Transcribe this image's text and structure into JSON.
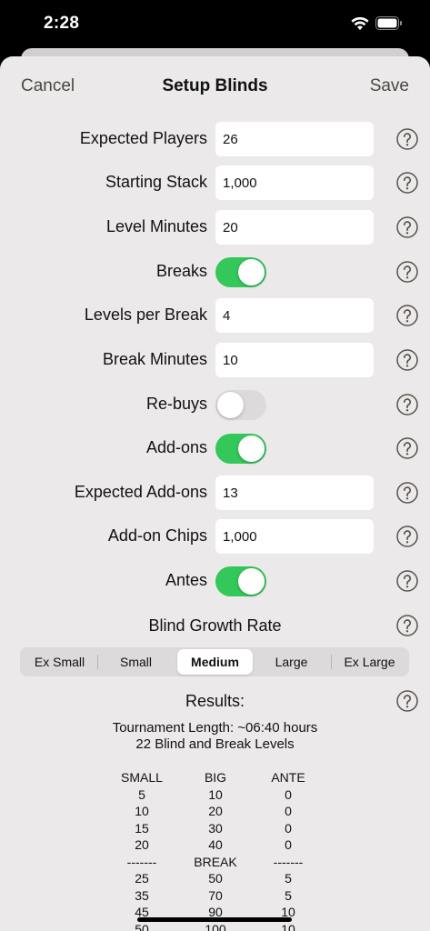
{
  "status": {
    "time": "2:28"
  },
  "nav": {
    "cancel": "Cancel",
    "title": "Setup Blinds",
    "save": "Save"
  },
  "form": {
    "expected_players": {
      "label": "Expected Players",
      "value": "26"
    },
    "starting_stack": {
      "label": "Starting Stack",
      "value": "1,000"
    },
    "level_minutes": {
      "label": "Level Minutes",
      "value": "20"
    },
    "breaks": {
      "label": "Breaks",
      "on": true
    },
    "levels_per_break": {
      "label": "Levels per Break",
      "value": "4"
    },
    "break_minutes": {
      "label": "Break Minutes",
      "value": "10"
    },
    "rebuys": {
      "label": "Re-buys",
      "on": false
    },
    "addons": {
      "label": "Add-ons",
      "on": true
    },
    "expected_addons": {
      "label": "Expected Add-ons",
      "value": "13"
    },
    "addon_chips": {
      "label": "Add-on Chips",
      "value": "1,000"
    },
    "antes": {
      "label": "Antes",
      "on": true
    }
  },
  "growth": {
    "label": "Blind Growth Rate",
    "options": [
      "Ex Small",
      "Small",
      "Medium",
      "Large",
      "Ex Large"
    ],
    "selected": "Medium"
  },
  "results": {
    "title": "Results:",
    "length": "Tournament Length: ~06:40 hours",
    "levels": "22 Blind and Break Levels",
    "columns": {
      "small": [
        "SMALL",
        "5",
        "10",
        "15",
        "20",
        "-------",
        "25",
        "35",
        "45",
        "50"
      ],
      "big": [
        "BIG",
        "10",
        "20",
        "30",
        "40",
        "BREAK",
        "50",
        "70",
        "90",
        "100"
      ],
      "ante": [
        "ANTE",
        "0",
        "0",
        "0",
        "0",
        "-------",
        "5",
        "5",
        "10",
        "10"
      ]
    }
  },
  "colors": {
    "toggle_on": "#34c759",
    "toggle_off": "#dcdadb",
    "sheet_bg": "#ebe9ea",
    "nav_button": "#4d4741"
  }
}
